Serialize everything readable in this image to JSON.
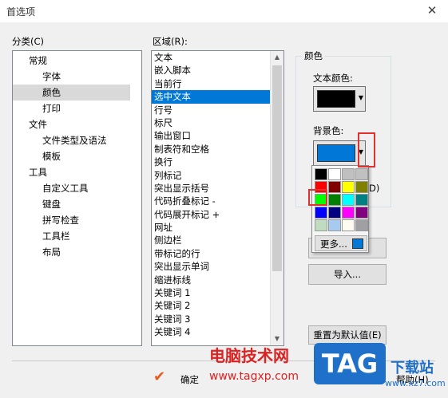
{
  "window": {
    "title": "首选项",
    "close": "✕"
  },
  "category": {
    "label": "分类(C)",
    "items": [
      {
        "label": "常规",
        "level": 0
      },
      {
        "label": "字体",
        "level": 1
      },
      {
        "label": "颜色",
        "level": 1,
        "selected": true
      },
      {
        "label": "打印",
        "level": 1
      },
      {
        "label": "文件",
        "level": 0
      },
      {
        "label": "文件类型及语法",
        "level": 1
      },
      {
        "label": "模板",
        "level": 1
      },
      {
        "label": "工具",
        "level": 0
      },
      {
        "label": "自定义工具",
        "level": 1
      },
      {
        "label": "键盘",
        "level": 1
      },
      {
        "label": "拼写检查",
        "level": 1
      },
      {
        "label": "工具栏",
        "level": 1
      },
      {
        "label": "布局",
        "level": 1
      }
    ]
  },
  "region": {
    "label": "区域(R):",
    "items": [
      "文本",
      "嵌入脚本",
      "当前行",
      "选中文本",
      "行号",
      "标尺",
      "输出窗口",
      "制表符和空格",
      "换行",
      "列标记",
      "突出显示括号",
      "代码折叠标记 -",
      "代码展开标记 +",
      "网址",
      "侧边栏",
      "带标记的行",
      "突出显示单词",
      "缩进标线",
      "关键词 1",
      "关键词 2",
      "关键词 3",
      "关键词 4"
    ],
    "selected_index": 3
  },
  "colors": {
    "group_label": "颜色",
    "text_color_label": "文本颜色:",
    "text_color": "#000000",
    "bg_color_label": "背景色:",
    "bg_color": "#0078d7",
    "palette": [
      "#000000",
      "#ffffff",
      "#c0c0c0",
      "#c0c0c0",
      "#ff0000",
      "#800000",
      "#ffff00",
      "#808000",
      "#00ff00",
      "#008000",
      "#00ffff",
      "#008080",
      "#0000ff",
      "#000080",
      "#ff00ff",
      "#800080",
      "#c0dcc0",
      "#a6caf0",
      "#fffbf0",
      "#a0a0a4"
    ],
    "more_label": "更多...",
    "hidden_fragment": "D)"
  },
  "buttons": {
    "import": "导入...",
    "reset": "重置为默认值(E)",
    "ok": "确定",
    "help": "帮助(H)"
  },
  "watermark": {
    "site_name": "电脑技术网",
    "site_url": "www.tagxp.com",
    "tag": "TAG",
    "download": "下载站",
    "download_url": "www.xz7.com"
  }
}
